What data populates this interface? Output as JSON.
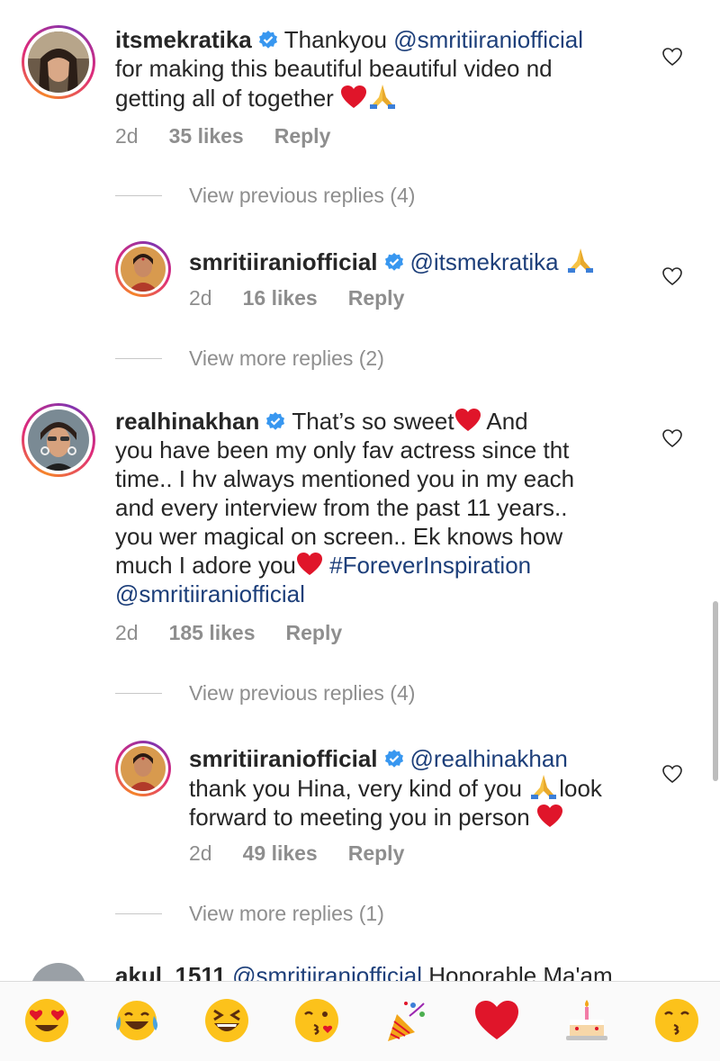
{
  "comments": [
    {
      "username": "itsmekratika",
      "segments": [
        {
          "type": "text",
          "text": "Thankyou "
        },
        {
          "type": "mention",
          "text": "@smritiiraniofficial"
        },
        {
          "type": "text",
          "text": " for making this beautiful beautiful video nd getting all of together "
        }
      ],
      "emojis": [
        "red-heart",
        "folded-hands"
      ],
      "time": "2d",
      "likes": "35 likes",
      "reply": "Reply"
    },
    {
      "view_previous": "View previous replies (4)"
    },
    {
      "username": "smritiiraniofficial",
      "segments": [
        {
          "type": "mention",
          "text": "@itsmekratika"
        }
      ],
      "emojis": [
        "folded-hands"
      ],
      "time": "2d",
      "likes": "16 likes",
      "reply": "Reply"
    },
    {
      "view_more": "View more replies (2)"
    }
  ],
  "hina": {
    "username": "realhinakhan",
    "line1": "That’s so sweet",
    "line1b": " And",
    "line2": "you have been my only fav actress since tht",
    "line3": "time.. I hv always mentioned you in my each",
    "line4": "and every interview from the past 11 years..",
    "line5": "you wer magical on screen.. Ek knows how",
    "line6": "much I adore you",
    "hashtag": "#ForeverInspiration",
    "mention": "@smritiiranioffi​cial",
    "time": "2d",
    "likes": "185 likes",
    "reply": "Reply",
    "view_previous": "View previous replies (4)"
  },
  "smriti2": {
    "username": "smritiiraniofficial",
    "mention": "@realhinakhan",
    "line2a": "thank you Hina, very kind of you ",
    "line2b": "look",
    "line3": "forward to meeting you in person ",
    "time": "2d",
    "likes": "49 likes",
    "reply": "Reply",
    "view_more": "View more replies (1)"
  },
  "kratika": {
    "username": "itsmekratika",
    "thanks": "Thankyou",
    "mention": "@smritiiranioffi​cial",
    "line2": "for making this beautiful beautiful video nd",
    "line3": "getting all of together",
    "time": "2d",
    "likes": "35 likes",
    "reply": "Reply",
    "view_previous": "View previous replies (4)"
  },
  "smriti1": {
    "username": "smritiiraniofficial",
    "mention": "@itsmekratika",
    "time": "2d",
    "likes": "16 likes",
    "reply": "Reply",
    "view_more": "View more replies (2)"
  },
  "akul": {
    "username": "akul_1511",
    "mention": "@smritiiranioffi​cial",
    "text": "Honorable Ma'am"
  },
  "emoji_bar": [
    "heart-eyes-face-icon",
    "tears-of-joy-face-icon",
    "grinning-squinting-face-icon",
    "face-blowing-kiss-icon",
    "party-popper-icon",
    "red-heart-icon",
    "birthday-cake-icon",
    "kissing-face-icon"
  ],
  "colors": {
    "mention": "#1d3f7a",
    "muted": "#8e8e8e",
    "verified": "#3897f0",
    "heart": "#e0152a"
  }
}
